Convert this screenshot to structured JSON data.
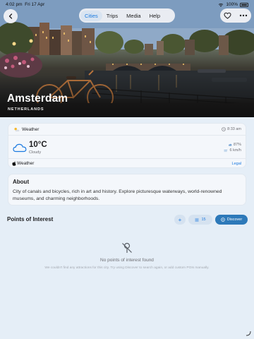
{
  "status_bar": {
    "time": "4:02 pm",
    "date": "Fri 17 Apr",
    "battery": "100%"
  },
  "nav": {
    "tabs": [
      {
        "label": "Cities",
        "active": true
      },
      {
        "label": "Trips",
        "active": false
      },
      {
        "label": "Media",
        "active": false
      },
      {
        "label": "Help",
        "active": false
      }
    ]
  },
  "hero": {
    "city": "Amsterdam",
    "country": "NETHERLANDS"
  },
  "weather": {
    "header": "Weather",
    "time": "8:33 am",
    "temperature": "10°C",
    "condition": "Cloudy",
    "humidity": "87%",
    "wind": "6 km/h",
    "brand": "Weather",
    "legal": "Legal"
  },
  "about": {
    "title": "About",
    "text": "City of canals and bicycles, rich in art and history. Explore picturesque waterways, world-renowned museums, and charming neighborhoods."
  },
  "poi": {
    "title": "Points of Interest",
    "add_label": "+",
    "sort_count": "15",
    "discover_label": "Discover",
    "empty_title": "No points of interest found",
    "empty_desc": "We couldn't find any attractions for this city. Try using Discover to search again, or add custom POIs manually."
  },
  "colors": {
    "accent": "#1b7ae0",
    "discover_bg": "#2d79b9",
    "background": "#e5eef7",
    "card": "#f4f7fb"
  },
  "icons": [
    "back-chevron-icon",
    "heart-icon",
    "more-icon",
    "sun-cloud-icon",
    "clock-icon",
    "cloud-icon",
    "humidity-icon",
    "wind-icon",
    "apple-icon",
    "list-icon",
    "discover-icon",
    "no-location-icon"
  ]
}
